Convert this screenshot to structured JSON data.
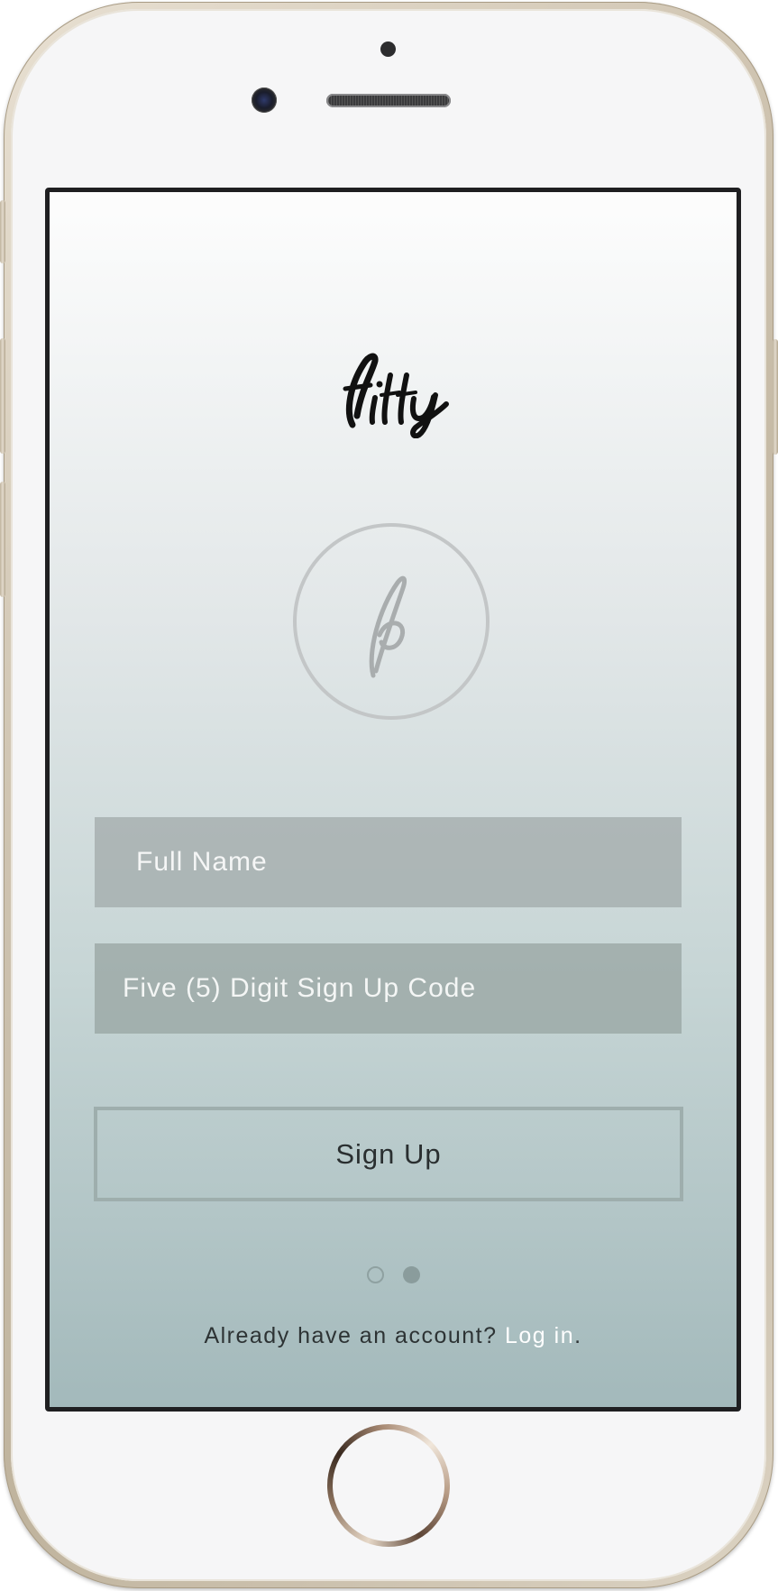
{
  "app": {
    "brand_name": "fitty",
    "badge_letter": "f"
  },
  "form": {
    "name_placeholder": "Full Name",
    "code_placeholder": "Five (5) Digit Sign Up Code",
    "submit_label": "Sign Up"
  },
  "pager": {
    "total": 2,
    "active_index": 1
  },
  "footer": {
    "prompt": "Already have an account?",
    "login_link": "Log in",
    "trailing_punct": "."
  },
  "colors": {
    "screen_top": "#fdfdfd",
    "screen_bottom": "#a3b9bb",
    "input_fill": "#a0a8a8",
    "button_border": "#9eaead",
    "link": "#ffffff",
    "phone_gold": "#cfc4b1"
  },
  "icons": {
    "brand": "fitty-script-wordmark",
    "badge": "circle-f-monogram-icon"
  }
}
